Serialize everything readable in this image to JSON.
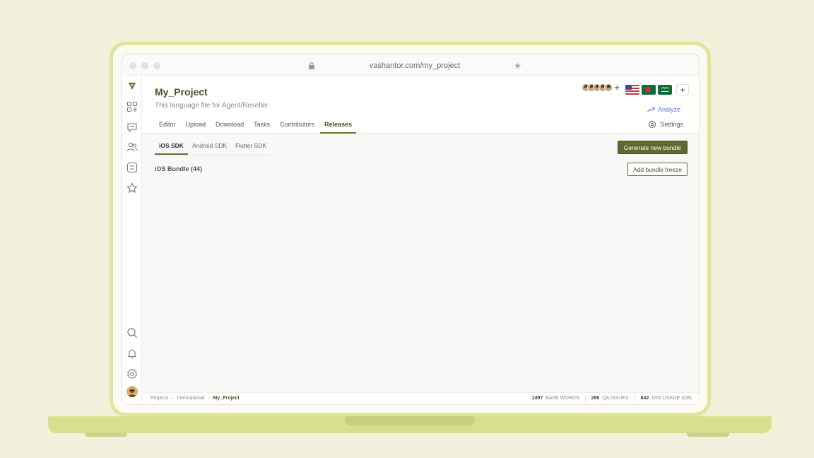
{
  "browser": {
    "url": "vashantor.com/my_project"
  },
  "project": {
    "title": "My_Project",
    "subtitle": "This language file for Agent/Reseller"
  },
  "tabs": [
    {
      "label": "Editor"
    },
    {
      "label": "Upload"
    },
    {
      "label": "Download"
    },
    {
      "label": "Tasks"
    },
    {
      "label": "Contributors"
    },
    {
      "label": "Releases",
      "active": true
    }
  ],
  "header_actions": {
    "analyze_label": "Analyze",
    "settings_label": "Settings",
    "contributors_plus": "+",
    "languages_plus": "+",
    "flags": [
      "us-flag",
      "bangladesh-flag",
      "saudi-arabia-flag"
    ]
  },
  "sdk_tabs": [
    {
      "label": "iOS SDK",
      "active": true
    },
    {
      "label": "Android SDK"
    },
    {
      "label": "Flutter SDK"
    }
  ],
  "releases": {
    "bundle_label": "iOS Bundle (44)",
    "generate_button": "Generate new bundle",
    "freeze_button": "Add bundle freeze"
  },
  "footer": {
    "breadcrumb": [
      "Projects",
      "International",
      "My_Project"
    ],
    "breadcrumb_sep": "›",
    "stats": [
      {
        "value": "1497",
        "label": "BASE WORDS"
      },
      {
        "value": "286",
        "label": "QA ISSUES"
      },
      {
        "value": "642",
        "label": "OTA USAGE (GB)"
      }
    ]
  },
  "colors": {
    "accent": "#5e6a30",
    "background": "#f2f2dc",
    "laptop": "#dde69a",
    "link": "#5a7dd6"
  }
}
